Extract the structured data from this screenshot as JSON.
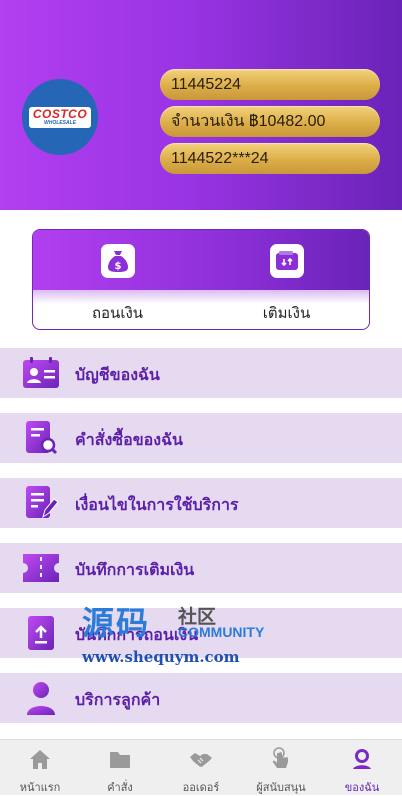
{
  "header": {
    "logo": {
      "brand": "COSTCO",
      "sub": "WHOLESALE"
    },
    "account_id": "11445224",
    "balance": "จำนวนเงิน ฿10482.00",
    "masked_id": "1144522***24"
  },
  "actions": {
    "withdraw": {
      "label": "ถอนเงิน",
      "icon": "money-bag-icon"
    },
    "topup": {
      "label": "เติมเงิน",
      "icon": "wallet-icon"
    }
  },
  "menu": {
    "items": [
      {
        "label": "บัญชีของฉัน",
        "icon": "id-card-icon"
      },
      {
        "label": "คำสั่งซื้อของฉัน",
        "icon": "order-search-icon"
      },
      {
        "label": "เงื่อนไขในการใช้บริการ",
        "icon": "terms-edit-icon"
      },
      {
        "label": "บันทึกการเติมเงิน",
        "icon": "ticket-icon"
      },
      {
        "label": "บันทึกการถอนเงิน",
        "icon": "upload-icon"
      },
      {
        "label": "บริการลูกค้า",
        "icon": "customer-service-icon"
      }
    ]
  },
  "watermark": {
    "big": "源码",
    "cn": "社区",
    "community": "COMMUNITY",
    "url": "www.shequym.com"
  },
  "tabbar": {
    "items": [
      {
        "label": "หน้าแรก",
        "icon": "home-icon"
      },
      {
        "label": "คำสั่ง",
        "icon": "folder-icon"
      },
      {
        "label": "ออเดอร์",
        "icon": "handshake-icon"
      },
      {
        "label": "ผู้สนับสนุน",
        "icon": "pointer-hand-icon"
      },
      {
        "label": "ของฉัน",
        "icon": "user-icon"
      }
    ],
    "active_index": 4
  },
  "colors": {
    "primary": "#8b2fd7",
    "primary_dark": "#6a23b8",
    "gold": "#dcae48",
    "menu_bg": "#e6daf1"
  }
}
